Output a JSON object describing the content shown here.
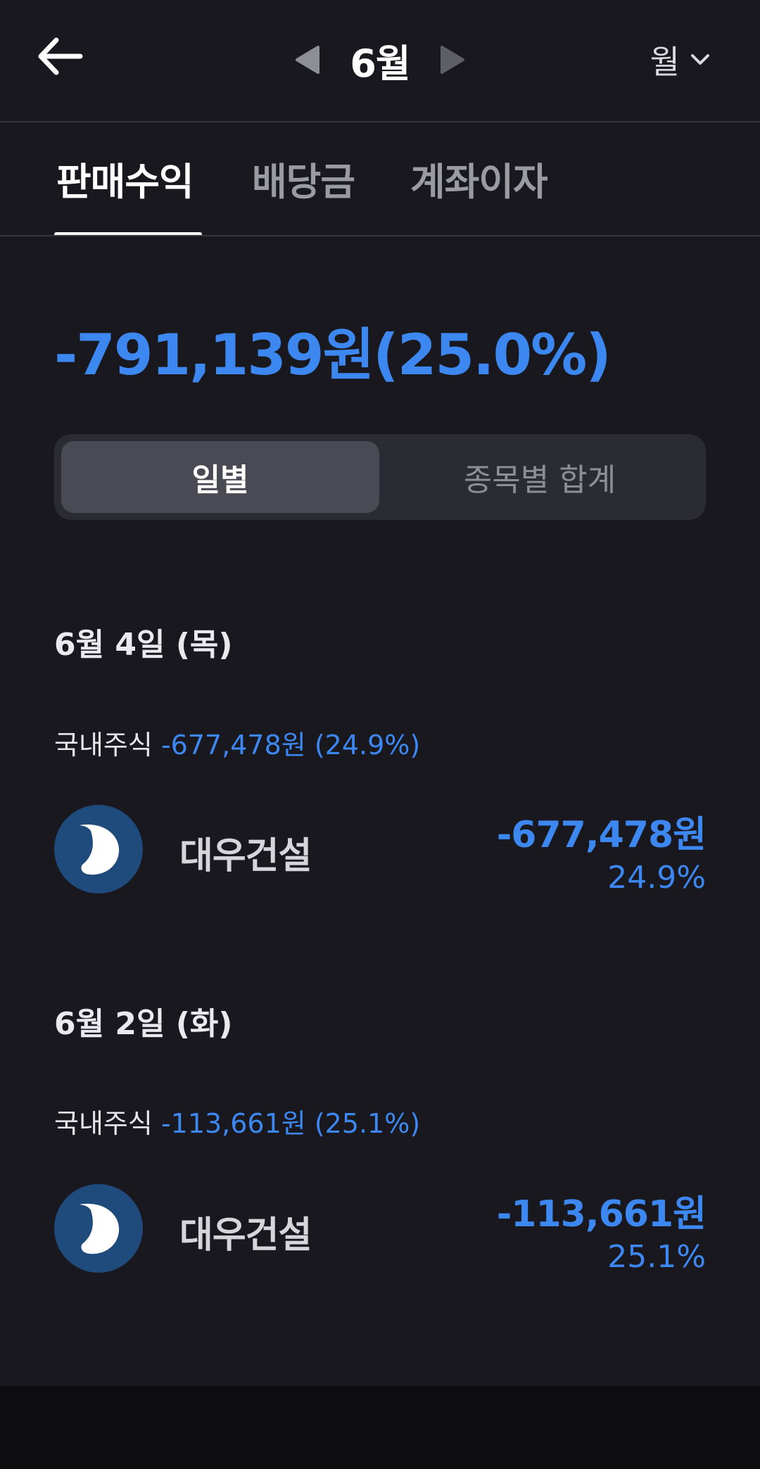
{
  "header": {
    "month": "6월",
    "period": "월",
    "icons": {
      "back": "arrow-left-icon",
      "prev": "triangle-left-icon",
      "next": "triangle-right-icon",
      "period": "chevron-down-icon"
    }
  },
  "tabs": [
    {
      "label": "판매수익",
      "active": true
    },
    {
      "label": "배당금",
      "active": false
    },
    {
      "label": "계좌이자",
      "active": false
    }
  ],
  "summary": {
    "total": "-791,139원(25.0%)",
    "color": "#3d87f0"
  },
  "segment": {
    "daily": "일별",
    "by_stock": "종목별 합계",
    "selected": "일별"
  },
  "days": [
    {
      "date": "6월 4일 (목)",
      "category": "국내주식",
      "category_amount": "-677,478원 (24.9%)",
      "items": [
        {
          "name": "대우건설",
          "amount": "-677,478원",
          "percent": "24.9%",
          "logo": "daewoo-logo-icon"
        }
      ]
    },
    {
      "date": "6월 2일 (화)",
      "category": "국내주식",
      "category_amount": "-113,661원 (25.1%)",
      "items": [
        {
          "name": "대우건설",
          "amount": "-113,661원",
          "percent": "25.1%",
          "logo": "daewoo-logo-icon"
        }
      ]
    }
  ],
  "colors": {
    "background": "#18181e",
    "negative": "#3d87f0",
    "logo_bg": "#1f4a7c"
  }
}
